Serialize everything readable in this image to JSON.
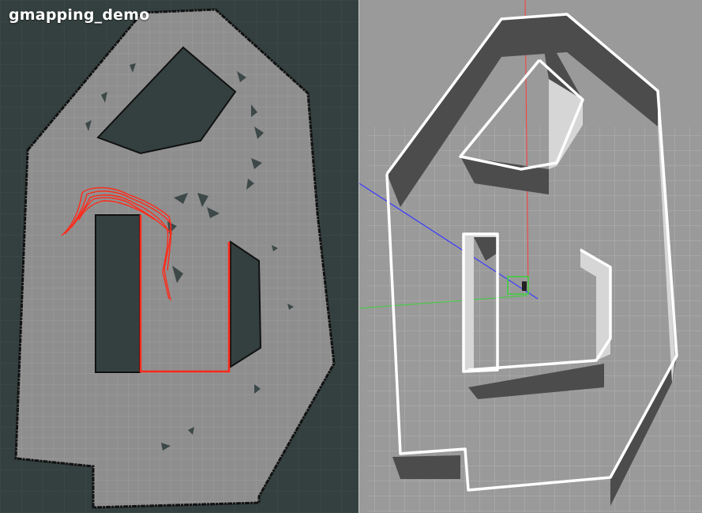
{
  "title": "gmapping_demo",
  "colors": {
    "rviz_background": "#34403f",
    "map_free": "#8e8e8e",
    "map_grid": "#9d9d9d",
    "map_wall": "#111111",
    "laser_scan": "#ff2a1a",
    "gazebo_background": "#9a9a9a",
    "gazebo_wall_top": "#ffffff",
    "gazebo_wall_side": "#4a4a4a",
    "axis_x": "#ff3b3b",
    "axis_y": "#3bd13b",
    "axis_z": "#3b3bff"
  },
  "panels": {
    "left": "rviz-occupancy-map",
    "right": "gazebo-world-view"
  }
}
